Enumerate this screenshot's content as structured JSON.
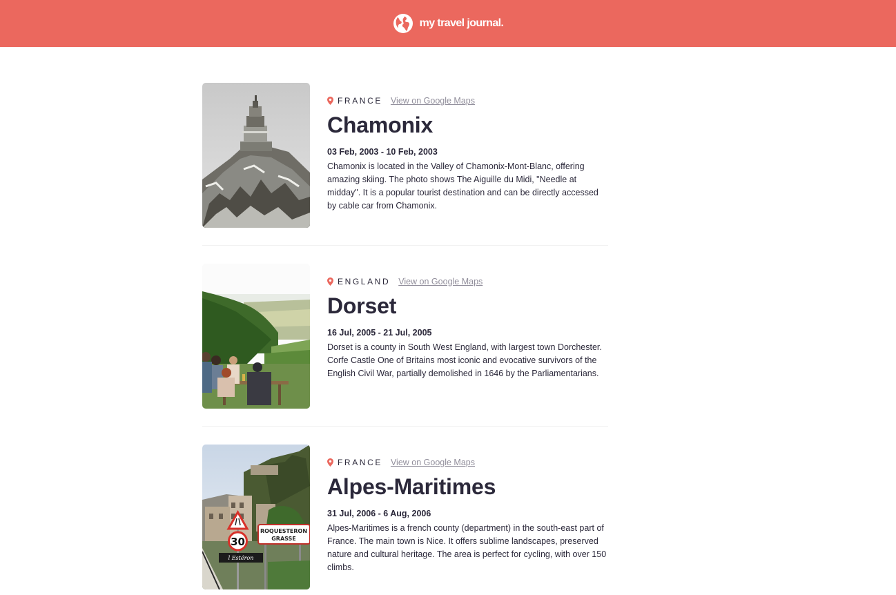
{
  "header": {
    "title": "my travel journal.",
    "icon": "globe-icon",
    "bg_color": "#eb685e"
  },
  "entries": [
    {
      "country": "FRANCE",
      "map_link": "View on Google Maps",
      "place": "Chamonix",
      "dates": "03 Feb, 2003 - 10 Feb, 2003",
      "description": "Chamonix is located in the Valley of Chamonix-Mont-Blanc, offering amazing skiing. The photo shows The Aiguille du Midi, \"Needle at midday\". It is a popular tourist destination and can be directly accessed by cable car from Chamonix."
    },
    {
      "country": "ENGLAND",
      "map_link": "View on Google Maps",
      "place": "Dorset",
      "dates": "16 Jul, 2005 - 21 Jul, 2005",
      "description": "Dorset is a county in South West England, with largest town Dorchester. Corfe Castle One of Britains most iconic and evocative survivors of the English Civil War, partially demolished in 1646 by the Parliamentarians."
    },
    {
      "country": "FRANCE",
      "map_link": "View on Google Maps",
      "place": "Alpes-Maritimes",
      "dates": "31 Jul, 2006 - 6 Aug, 2006",
      "description": "Alpes-Maritimes is a french county (department) in the south-east part of France. The main town is Nice. It offers sublime landscapes, preserved nature and cultural heritage. The area is perfect for cycling, with over 150 climbs."
    }
  ],
  "photo3_signs": {
    "speed": "30",
    "town_line1": "ROQUESTERON",
    "town_line2": "GRASSE",
    "river": "l Estéron"
  },
  "accent_color": "#eb685e"
}
